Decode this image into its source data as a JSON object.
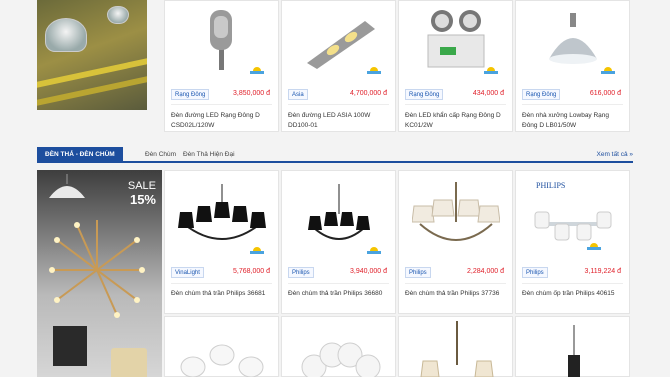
{
  "row1": {
    "products": [
      {
        "brand": "Rạng Đông",
        "price": "3,850,000 đ",
        "name": "Đèn đường LED Rạng Đông D CSD02L/120W",
        "icon": "street-light-icon"
      },
      {
        "brand": "Asia",
        "price": "4,700,000 đ",
        "name": "Đèn đường LED ASIA 100W DD100-01",
        "icon": "street-light-icon"
      },
      {
        "brand": "Rạng Đông",
        "price": "434,000 đ",
        "name": "Đèn LED khẩn cấp Rạng Đông D KC01/2W",
        "icon": "emergency-light-icon"
      },
      {
        "brand": "Rạng Đông",
        "price": "616,000 đ",
        "name": "Đèn nhà xưởng Lowbay Rạng Đông D LB01/50W",
        "icon": "lowbay-light-icon"
      }
    ]
  },
  "category": {
    "title": "ĐÈN THẢ - ĐÈN CHÙM",
    "subcats": [
      "Đèn Chùm",
      "Đèn Thả Hiện Đại"
    ],
    "view_all": "Xem tất cả »"
  },
  "banner": {
    "sale": "SALE",
    "percent": "15%"
  },
  "row2": {
    "products": [
      {
        "brand": "VinaLight",
        "price": "5,768,000 đ",
        "name": "Đèn chùm thả trần Philips 36681",
        "icon": "chandelier-icon"
      },
      {
        "brand": "Philips",
        "price": "3,940,000 đ",
        "name": "Đèn chùm thả trần Philips 36680",
        "icon": "chandelier-icon"
      },
      {
        "brand": "Philips",
        "price": "2,284,000 đ",
        "name": "Đèn chùm thả trần Philips 37736",
        "icon": "chandelier-icon"
      },
      {
        "brand": "Philips",
        "price": "3,119,224 đ",
        "name": "Đèn chùm ốp trần Philips 40615",
        "icon": "ceiling-lamp-icon",
        "logo": "PHILIPS"
      }
    ]
  },
  "row3": {
    "icons": [
      "globe-ceiling-lamp-icon",
      "bubble-ceiling-lamp-icon",
      "pendant-chandelier-icon",
      "pendant-lamp-icon"
    ]
  },
  "colors": {
    "accent": "#1d4e9e",
    "price": "#e0202a"
  }
}
